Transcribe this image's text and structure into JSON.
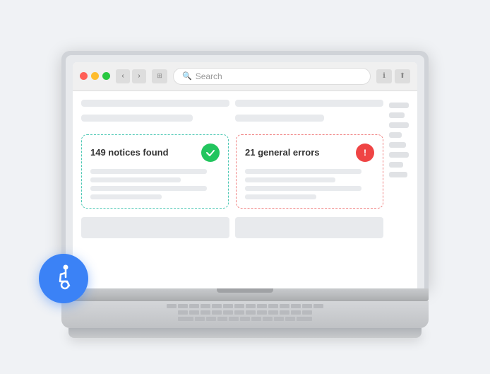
{
  "browser": {
    "traffic_lights": [
      "red",
      "yellow",
      "green"
    ],
    "nav_back": "‹",
    "nav_forward": "›",
    "window_icon": "⊞",
    "search_placeholder": "Search",
    "action_info": "ℹ",
    "action_share": "⬆"
  },
  "cards": [
    {
      "id": "notices",
      "title": "149 notices found",
      "icon_type": "green",
      "icon_symbol": "✓",
      "border_color": "#4dc8b4"
    },
    {
      "id": "errors",
      "title": "21 general errors",
      "icon_type": "red",
      "icon_symbol": "!",
      "border_color": "#f08080"
    }
  ],
  "accessibility": {
    "badge_label": "Accessibility",
    "icon": "♿"
  }
}
